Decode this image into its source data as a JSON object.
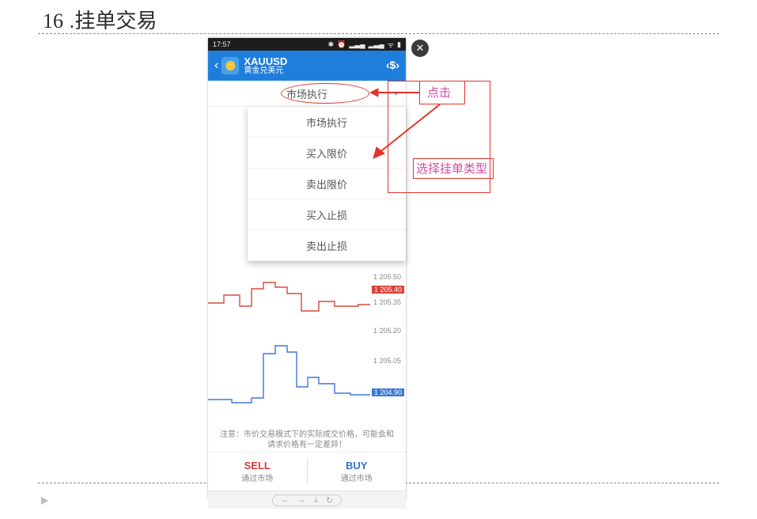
{
  "slide": {
    "number": "16",
    "title": "挂单交易"
  },
  "annotations": {
    "click": "点击",
    "choose_type": "选择挂单类型"
  },
  "statusbar": {
    "time": "17:57",
    "bt": "✱",
    "alarm": "⏰",
    "sig1": "▂▃▄",
    "sig2": "▂▃▄",
    "wifi": "ᯤ",
    "batt": "▮"
  },
  "appbar": {
    "back": "‹",
    "symbol": "XAUUSD",
    "subtitle": "黄金兑美元",
    "swap": "‹$›"
  },
  "selector": {
    "current": "市场执行",
    "caret": "▾",
    "options": [
      "市场执行",
      "买入限价",
      "卖出限价",
      "买入止损",
      "卖出止损"
    ]
  },
  "chart_data": {
    "type": "line",
    "ylabels": [
      "1 205.50",
      "1 205.35",
      "1 205.20",
      "1 205.05"
    ],
    "ask_tag": "1 205.40",
    "bid_tag": "1 204.90",
    "series": [
      {
        "name": "ask",
        "color": "#d94a3f",
        "points": [
          [
            0,
            56
          ],
          [
            20,
            56
          ],
          [
            20,
            46
          ],
          [
            40,
            46
          ],
          [
            40,
            60
          ],
          [
            55,
            60
          ],
          [
            55,
            38
          ],
          [
            70,
            38
          ],
          [
            70,
            30
          ],
          [
            85,
            30
          ],
          [
            85,
            36
          ],
          [
            100,
            36
          ],
          [
            100,
            44
          ],
          [
            118,
            44
          ],
          [
            118,
            66
          ],
          [
            140,
            66
          ],
          [
            140,
            54
          ],
          [
            160,
            54
          ],
          [
            160,
            60
          ],
          [
            190,
            60
          ],
          [
            190,
            58
          ],
          [
            205,
            58
          ]
        ]
      },
      {
        "name": "bid",
        "color": "#3a78d6",
        "points": [
          [
            0,
            178
          ],
          [
            30,
            178
          ],
          [
            30,
            182
          ],
          [
            55,
            182
          ],
          [
            55,
            176
          ],
          [
            70,
            176
          ],
          [
            70,
            120
          ],
          [
            85,
            120
          ],
          [
            85,
            110
          ],
          [
            100,
            110
          ],
          [
            100,
            118
          ],
          [
            112,
            118
          ],
          [
            112,
            162
          ],
          [
            126,
            162
          ],
          [
            126,
            150
          ],
          [
            140,
            150
          ],
          [
            140,
            158
          ],
          [
            160,
            158
          ],
          [
            160,
            170
          ],
          [
            180,
            170
          ],
          [
            180,
            172
          ],
          [
            205,
            172
          ]
        ]
      }
    ]
  },
  "note": "注意：市价交易模式下的实际成交价格，可能会和请求价格有一定差异！",
  "buttons": {
    "sell_t": "SELL",
    "sell_s": "通过市场",
    "buy_t": "BUY",
    "buy_s": "通过市场"
  },
  "nav": {
    "back": "←",
    "fwd": "→",
    "dl": "⤓",
    "reload": "↻"
  }
}
